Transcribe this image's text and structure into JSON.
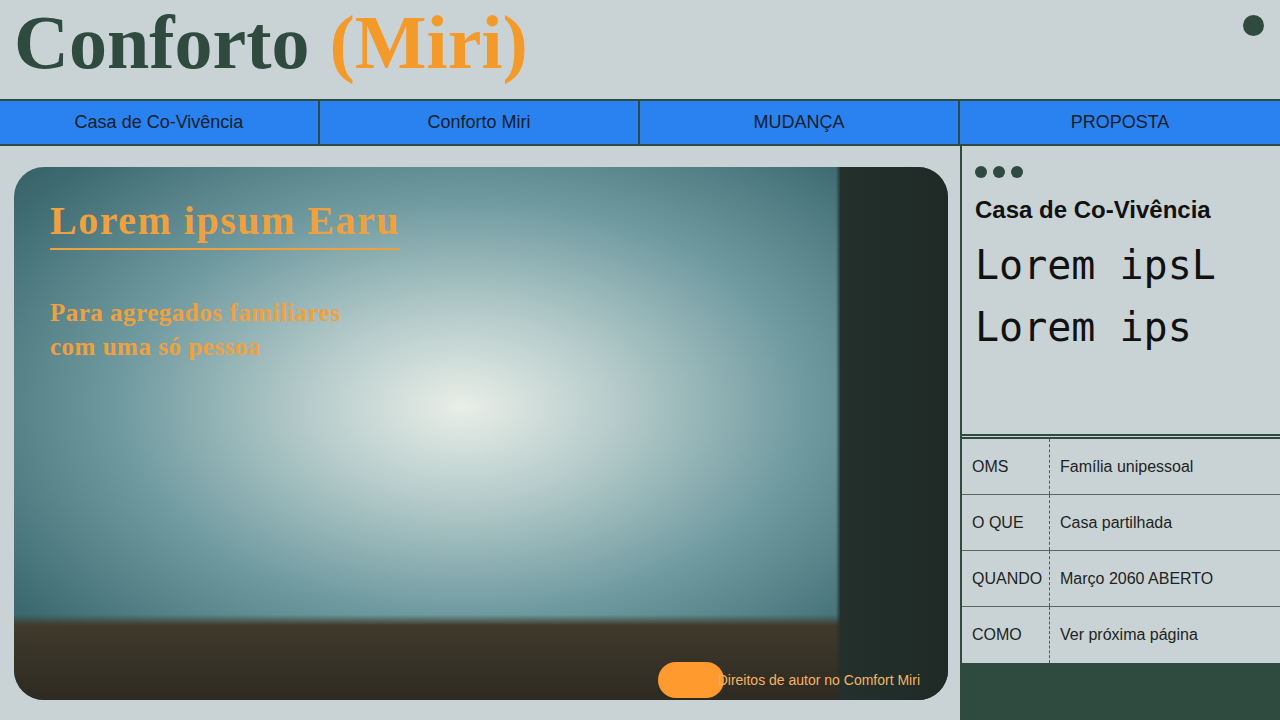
{
  "header": {
    "title": "Conforto",
    "title_accent": "(Miri)"
  },
  "nav": [
    {
      "label": "Casa de Co-Vivência"
    },
    {
      "label": "Conforto Miri"
    },
    {
      "label": "MUDANÇA"
    },
    {
      "label": "PROPOSTA"
    }
  ],
  "hero": {
    "title": "Lorem ipsum Earu",
    "subtitle_lines": [
      "Para agregados familiares",
      "com uma só pessoa"
    ],
    "credit": "Direitos de autor no Comfort Miri"
  },
  "sidebar": {
    "heading": "Casa de Co-Vivência",
    "lines": [
      "Lorem ipsL",
      "Lorem ips"
    ]
  },
  "table": {
    "rows": [
      {
        "label": "OMS",
        "value": "Família unipessoal"
      },
      {
        "label": "O QUE",
        "value": "Casa partilhada"
      },
      {
        "label": "QUANDO",
        "value": "Março 2060 ABERTO"
      },
      {
        "label": "COMO",
        "value": "Ver próxima página"
      }
    ]
  }
}
